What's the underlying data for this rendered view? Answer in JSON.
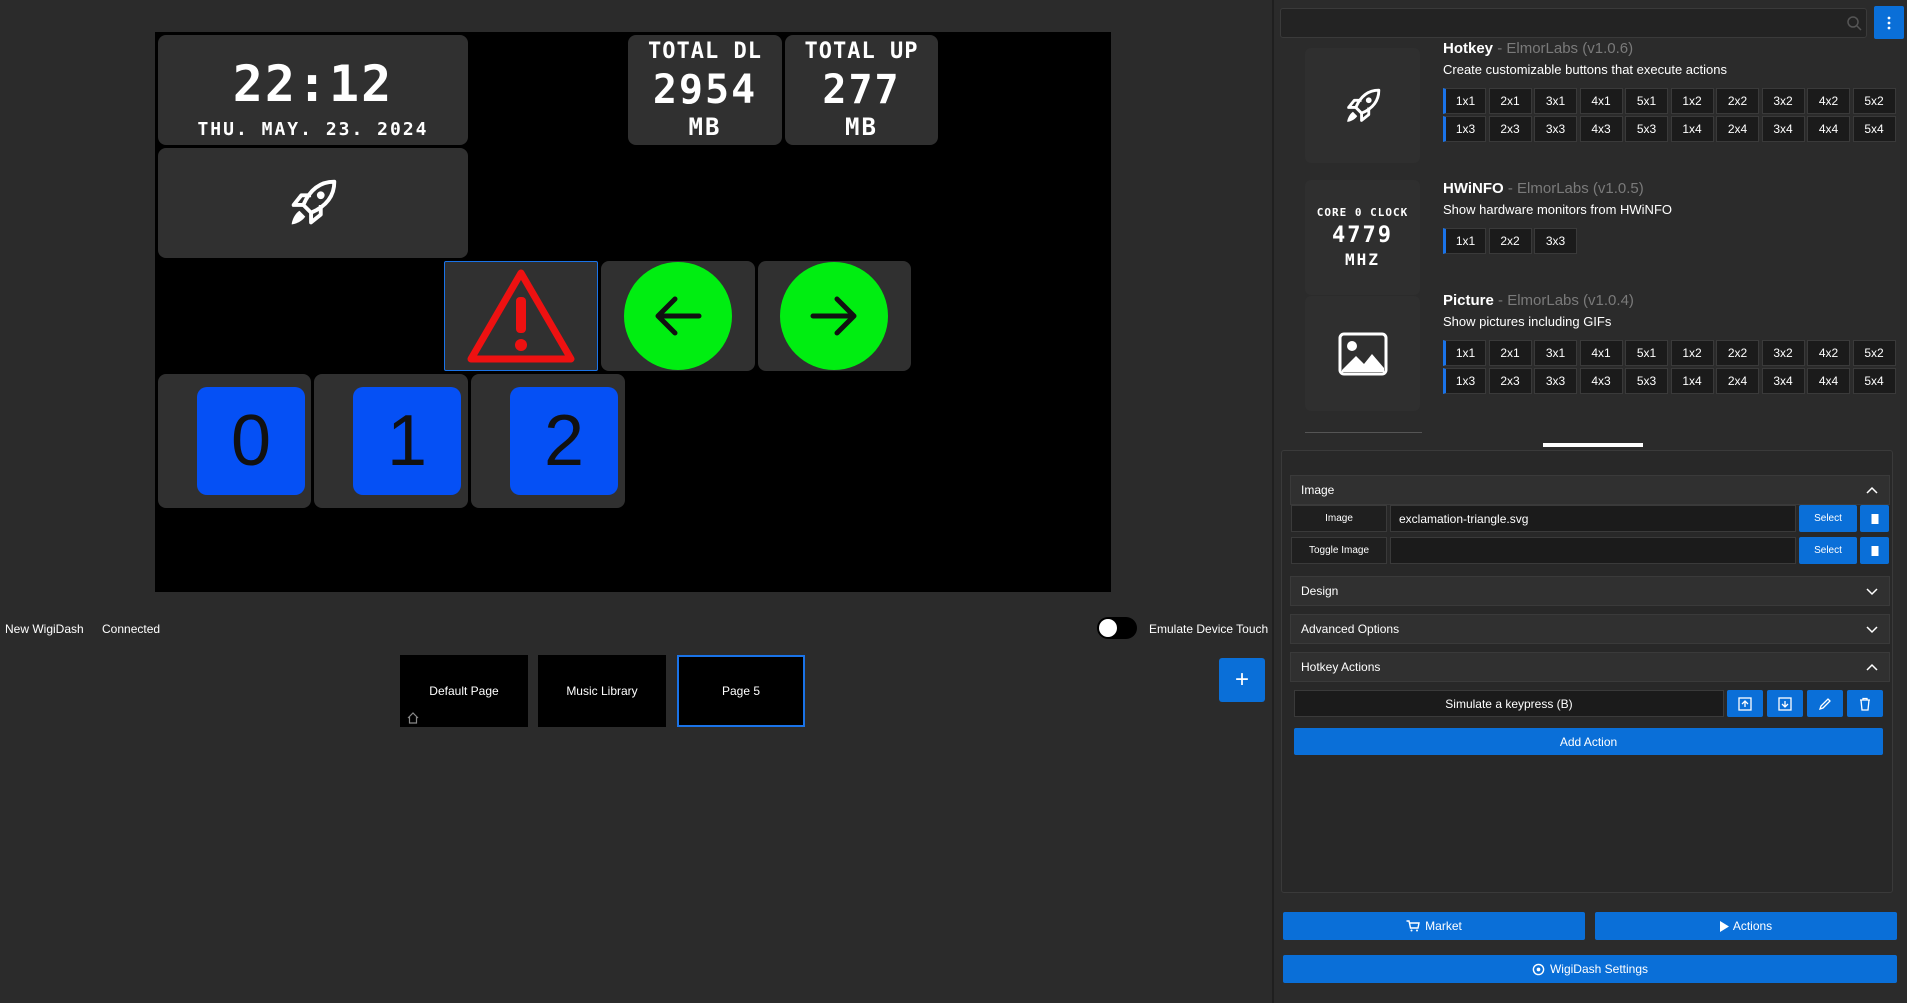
{
  "device": {
    "clock": {
      "time": "22:12",
      "date": "THU. MAY. 23. 2024"
    },
    "total_dl": {
      "label": "TOTAL DL",
      "value": "2954",
      "unit": "MB"
    },
    "total_up": {
      "label": "TOTAL UP",
      "value": "277",
      "unit": "MB"
    },
    "page_buttons": [
      "0",
      "1",
      "2"
    ]
  },
  "status": {
    "device_name": "New WigiDash",
    "connection": "Connected",
    "emulate_touch_label": "Emulate Device Touch"
  },
  "pages": {
    "items": [
      "Default Page",
      "Music Library",
      "Page 5"
    ],
    "add_label": "+"
  },
  "search": {
    "placeholder": ""
  },
  "menu_button_icon": "more-vertical-icon",
  "plugins": [
    {
      "name": "Hotkey",
      "meta": " - ElmorLabs (v1.0.6)",
      "description": "Create customizable buttons that execute actions",
      "icon": "rocket-icon",
      "sizes": [
        "1x1",
        "2x1",
        "3x1",
        "4x1",
        "5x1",
        "1x2",
        "2x2",
        "3x2",
        "4x2",
        "5x2",
        "1x3",
        "2x3",
        "3x3",
        "4x3",
        "5x3",
        "1x4",
        "2x4",
        "3x4",
        "4x4",
        "5x4"
      ]
    },
    {
      "name": "HWiNFO",
      "meta": " - ElmorLabs (v1.0.5)",
      "description": "Show hardware monitors from HWiNFO",
      "preview": {
        "label": "CORE 0 CLOCK",
        "value": "4779",
        "unit": "MHZ"
      },
      "sizes": [
        "1x1",
        "2x2",
        "3x3"
      ]
    },
    {
      "name": "Picture",
      "meta": " - ElmorLabs (v1.0.4)",
      "description": "Show pictures including GIFs",
      "icon": "image-icon",
      "sizes": [
        "1x1",
        "2x1",
        "3x1",
        "4x1",
        "5x1",
        "1x2",
        "2x2",
        "3x2",
        "4x2",
        "5x2",
        "1x3",
        "2x3",
        "3x3",
        "4x3",
        "5x3",
        "1x4",
        "2x4",
        "3x4",
        "4x4",
        "5x4"
      ]
    }
  ],
  "properties": {
    "image_section": "Image",
    "image_label": "Image",
    "image_value": "exclamation-triangle.svg",
    "toggle_image_label": "Toggle Image",
    "toggle_image_value": "",
    "select_label": "Select",
    "design_section": "Design",
    "advanced_section": "Advanced Options",
    "hotkey_section": "Hotkey Actions",
    "action_item": "Simulate a keypress (B)",
    "add_action": "Add Action"
  },
  "footer": {
    "market": "Market",
    "actions": "Actions",
    "settings": "WigiDash Settings"
  },
  "colors": {
    "accent": "#0a6fd8",
    "number_button": "#0550f5",
    "arrow_button": "#00ee11",
    "warning": "#ee1111"
  }
}
